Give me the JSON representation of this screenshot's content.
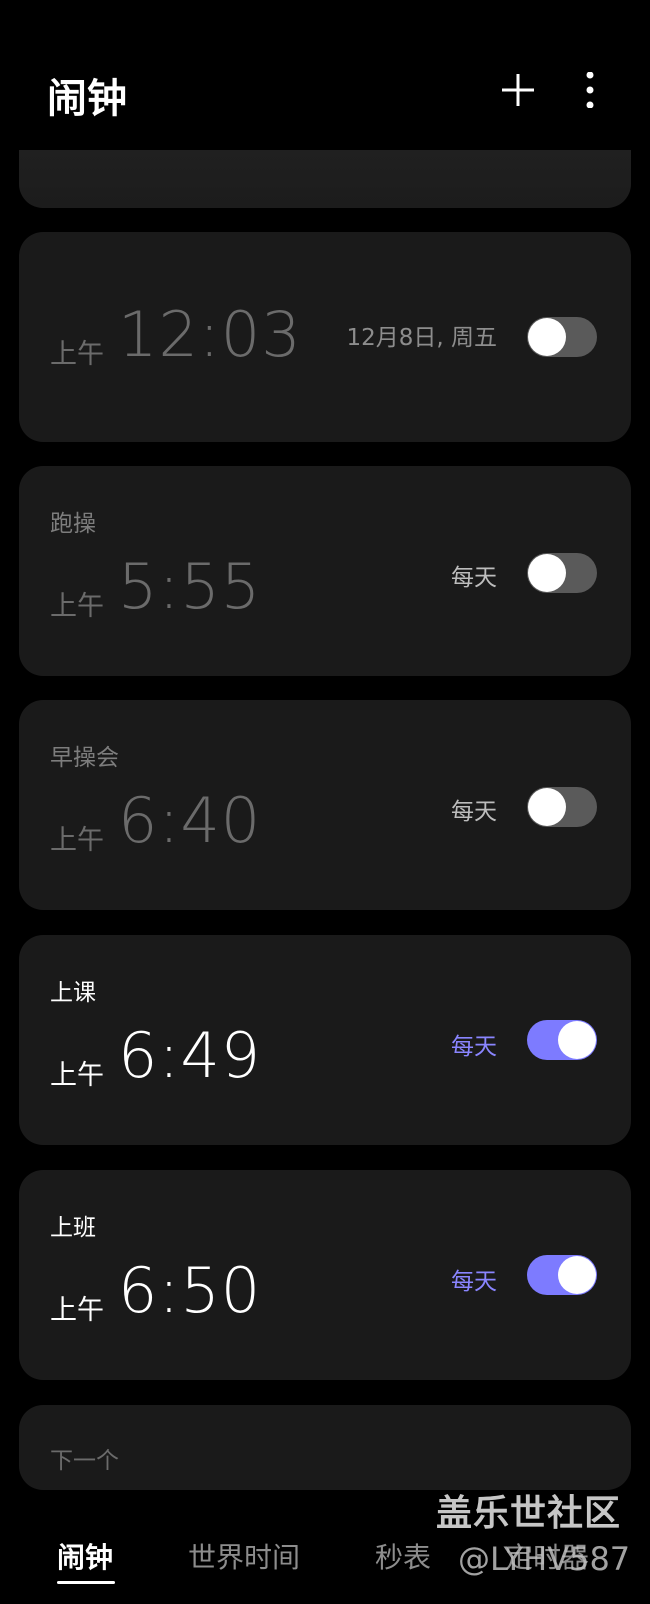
{
  "header": {
    "title": "闹钟"
  },
  "icons": {
    "add": "plus-icon",
    "more": "more-vertical-icon"
  },
  "colors": {
    "background": "#000000",
    "card": "#1a1a1a",
    "accent": "#7d7bff",
    "toggle_off": "#5a5a5a"
  },
  "alarms": [
    {
      "name": "",
      "ampm": "上午",
      "time": "12:03",
      "repeat": "12月8日, 周五",
      "enabled": false
    },
    {
      "name": "跑操",
      "ampm": "上午",
      "time": "5:55",
      "repeat": "每天",
      "enabled": false
    },
    {
      "name": "早操会",
      "ampm": "上午",
      "time": "6:40",
      "repeat": "每天",
      "enabled": false
    },
    {
      "name": "上课",
      "ampm": "上午",
      "time": "6:49",
      "repeat": "每天",
      "enabled": true
    },
    {
      "name": "上班",
      "ampm": "上午",
      "time": "6:50",
      "repeat": "每天",
      "enabled": true
    }
  ],
  "next_card": {
    "label": "下一个"
  },
  "bottom_nav": {
    "tabs": [
      {
        "label": "闹钟",
        "active": true
      },
      {
        "label": "世界时间",
        "active": false
      },
      {
        "label": "秒表",
        "active": false
      },
      {
        "label": "定时器",
        "active": false
      }
    ]
  },
  "watermark": {
    "site": "盖乐世社区",
    "user": "@LYHV587"
  }
}
